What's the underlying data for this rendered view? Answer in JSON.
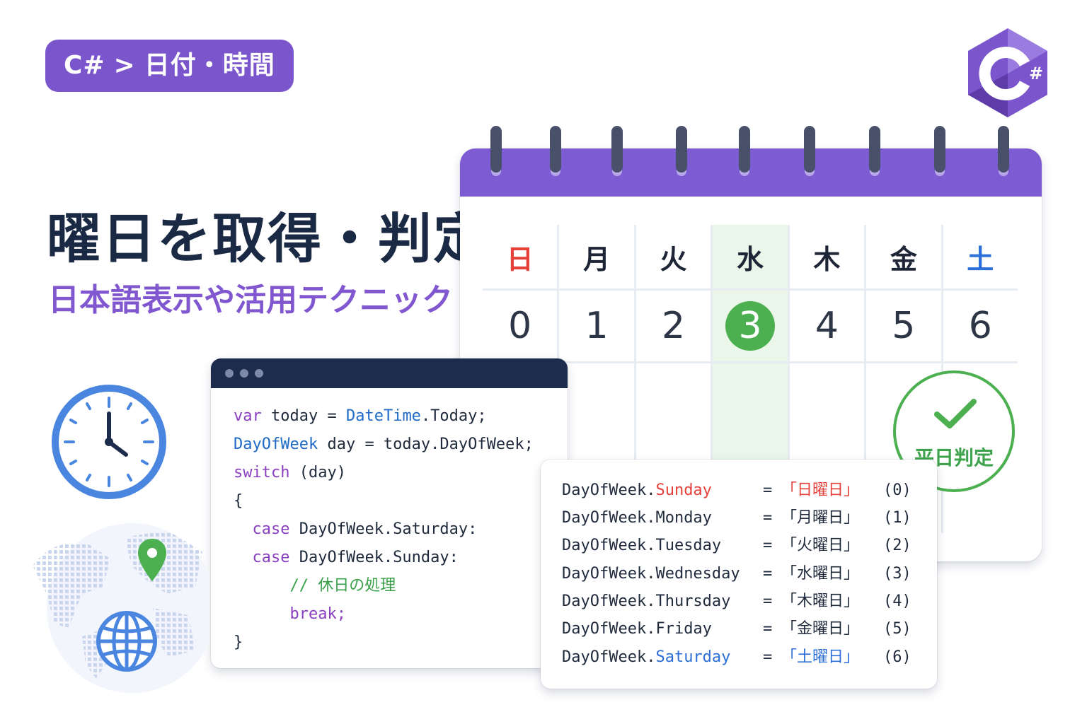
{
  "breadcrumb": {
    "parent": "C#",
    "separator": ">",
    "current": "日付・時間"
  },
  "logo": {
    "symbol": "#",
    "icon": "csharp-logo-icon",
    "color": "#7b55cc"
  },
  "heading": {
    "title": "曜日を取得・判定",
    "subtitle": "日本語表示や活用テクニック"
  },
  "calendar": {
    "weekdays": [
      "日",
      "月",
      "火",
      "水",
      "木",
      "金",
      "土"
    ],
    "numbers": [
      "0",
      "1",
      "2",
      "3",
      "4",
      "5",
      "6"
    ],
    "highlighted_index": 3,
    "header_color": "#7c5bd3",
    "highlight_color": "#4caf50"
  },
  "badge": {
    "label": "平日判定",
    "icon": "checkmark-icon",
    "color": "#4caf50"
  },
  "code": {
    "lines": {
      "l1a": "var",
      "l1b": " today = ",
      "l1c": "DateTime",
      "l1d": ".Today;",
      "l2a": "DayOfWeek",
      "l2b": " day = today.DayOfWeek;",
      "l3a": "switch",
      "l3b": " (day)",
      "l4": "{",
      "l5a": "  case",
      "l5b": " DayOfWeek.Saturday:",
      "l6a": "  case",
      "l6b": " DayOfWeek.Sunday:",
      "l7": "      // 休日の処理",
      "l8": "      break;",
      "l9": "}"
    }
  },
  "mapping": {
    "rows": [
      {
        "prefix": "DayOfWeek.",
        "name": "Sunday",
        "eq": "=",
        "jp": "「日曜日」",
        "index": "(0)"
      },
      {
        "prefix": "DayOfWeek.",
        "name": "Monday",
        "eq": "=",
        "jp": "「月曜日」",
        "index": "(1)"
      },
      {
        "prefix": "DayOfWeek.",
        "name": "Tuesday",
        "eq": "=",
        "jp": "「火曜日」",
        "index": "(2)"
      },
      {
        "prefix": "DayOfWeek.",
        "name": "Wednesday",
        "eq": "=",
        "jp": "「水曜日」",
        "index": "(3)"
      },
      {
        "prefix": "DayOfWeek.",
        "name": "Thursday",
        "eq": "=",
        "jp": "「木曜日」",
        "index": "(4)"
      },
      {
        "prefix": "DayOfWeek.",
        "name": "Friday",
        "eq": "=",
        "jp": "「金曜日」",
        "index": "(5)"
      },
      {
        "prefix": "DayOfWeek.",
        "name": "Saturday",
        "eq": "=",
        "jp": "「土曜日」",
        "index": "(6)"
      }
    ]
  },
  "decorations": {
    "clock": "clock-icon",
    "world": "world-map-icon",
    "globe": "globe-icon",
    "pin": "location-pin-icon"
  }
}
